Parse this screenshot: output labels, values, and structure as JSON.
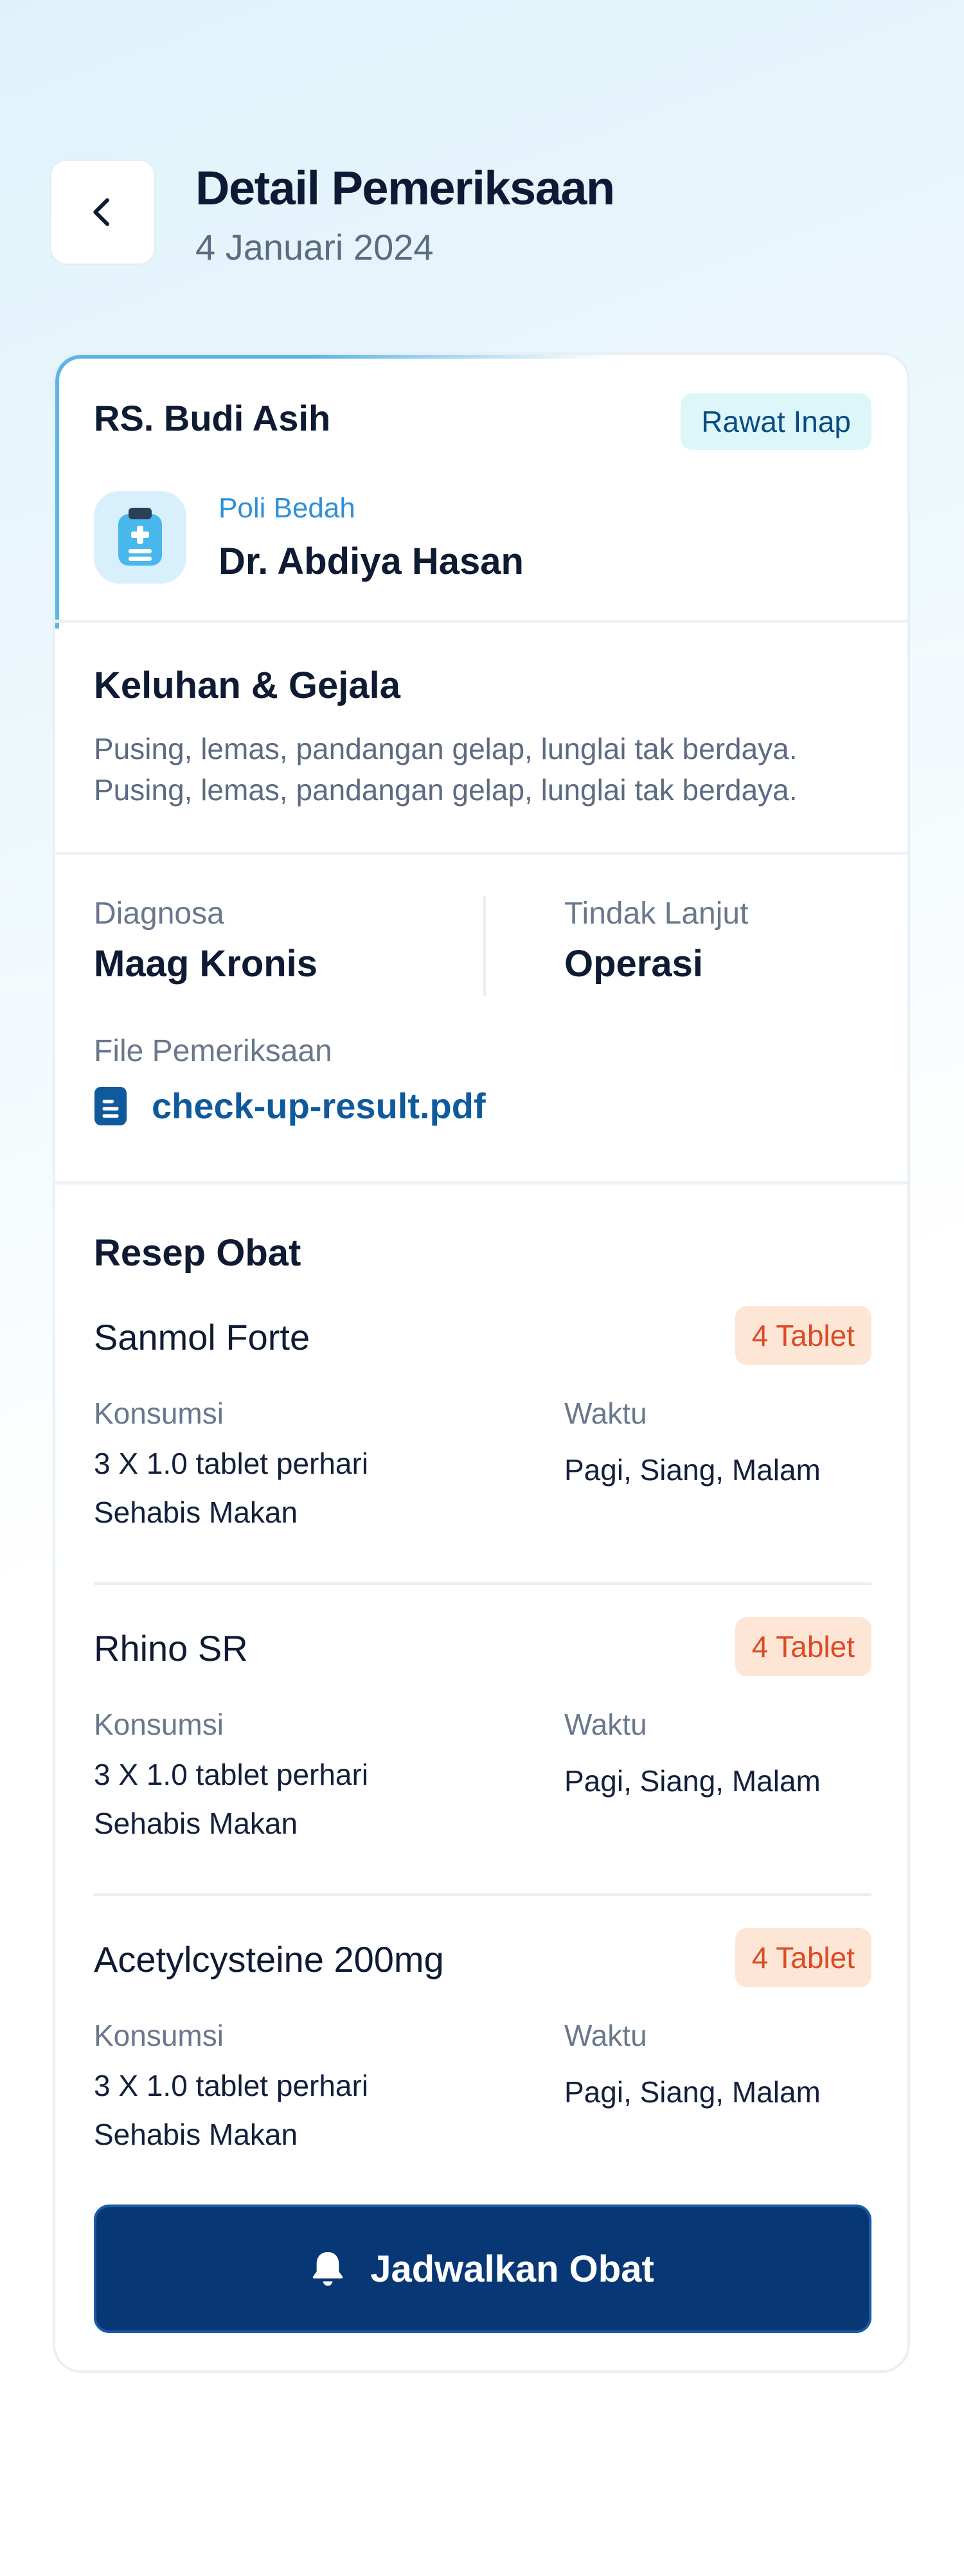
{
  "header": {
    "title": "Detail Pemeriksaan",
    "date": "4 Januari 2024",
    "back_icon": "chevron-left-icon"
  },
  "visit": {
    "hospital": "RS. Budi Asih",
    "type_badge": "Rawat Inap",
    "department": "Poli Bedah",
    "doctor": "Dr. Abdiya Hasan",
    "icon": "medical-clipboard-icon"
  },
  "complaint": {
    "title": "Keluhan & Gejala",
    "line1": "Pusing, lemas, pandangan gelap, lunglai tak berdaya.",
    "line2": "Pusing, lemas, pandangan gelap, lunglai tak berdaya."
  },
  "diagnosis": {
    "diagnosis_label": "Diagnosa",
    "diagnosis_value": "Maag Kronis",
    "followup_label": "Tindak Lanjut",
    "followup_value": "Operasi",
    "file_label": "File Pemeriksaan",
    "file_name": "check-up-result.pdf",
    "file_icon": "document-icon"
  },
  "prescription": {
    "title": "Resep Obat",
    "consume_label": "Konsumsi",
    "time_label": "Waktu",
    "items": [
      {
        "name": "Sanmol Forte",
        "badge": "4 Tablet",
        "dose": "3 X 1.0 tablet perhari",
        "when": "Sehabis Makan",
        "time": "Pagi, Siang, Malam"
      },
      {
        "name": "Rhino SR",
        "badge": "4 Tablet",
        "dose": "3 X 1.0 tablet perhari",
        "when": "Sehabis Makan",
        "time": "Pagi, Siang, Malam"
      },
      {
        "name": "Acetylcysteine 200mg",
        "badge": "4 Tablet",
        "dose": "3 X 1.0 tablet perhari",
        "when": "Sehabis Makan",
        "time": "Pagi, Siang, Malam"
      }
    ]
  },
  "cta": {
    "label": "Jadwalkan Obat",
    "icon": "bell-icon"
  },
  "colors": {
    "primary": "#073775",
    "accent_blue": "#2f8fd6",
    "badge_teal_bg": "#dcf6fa",
    "badge_orange_bg": "#fde6d6",
    "badge_orange_text": "#dc4b26"
  }
}
